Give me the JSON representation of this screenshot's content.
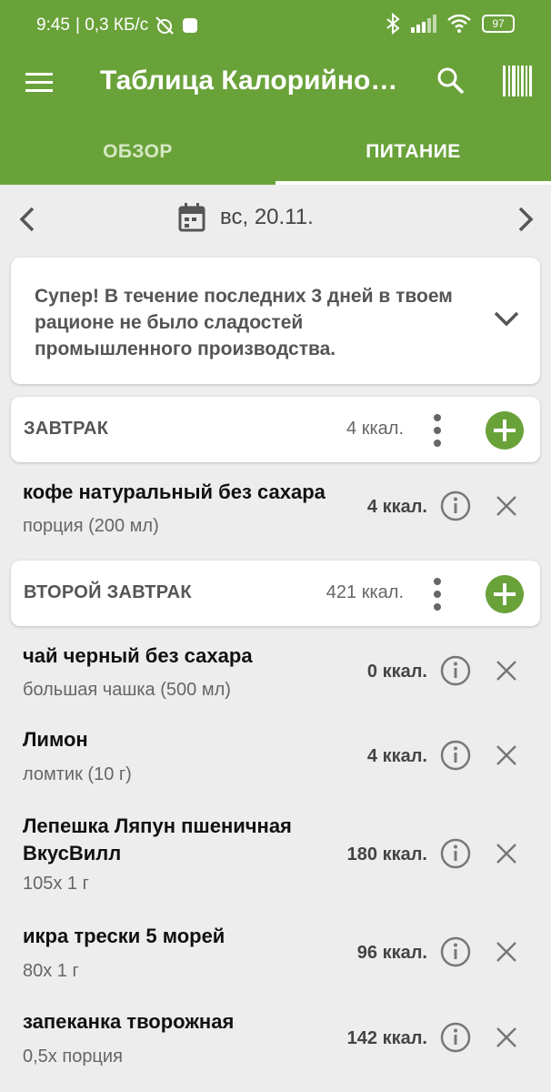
{
  "status_bar": {
    "time": "9:45",
    "net_speed": "| 0,3 КБ/с",
    "battery": "97"
  },
  "toolbar": {
    "title": "Таблица Калорийно…"
  },
  "tabs": [
    {
      "label": "ОБЗОР",
      "active": false
    },
    {
      "label": "ПИТАНИЕ",
      "active": true
    }
  ],
  "date_nav": {
    "date": "вс, 20.11."
  },
  "tip": {
    "text": "Супер! В течение последних 3 дней в твоем рационе не было сладостей промышленного производства."
  },
  "meals": [
    {
      "title": "ЗАВТРАК",
      "kcal": "4 ккал.",
      "items": [
        {
          "name": "кофе натуральный без сахара",
          "portion": "порция (200 мл)",
          "kcal": "4 ккал."
        }
      ]
    },
    {
      "title": "ВТОРОЙ ЗАВТРАК",
      "kcal": "421 ккал.",
      "items": [
        {
          "name": "чай черный без сахара",
          "portion": "большая чашка (500 мл)",
          "kcal": "0 ккал."
        },
        {
          "name": "Лимон",
          "portion": "ломтик (10 г)",
          "kcal": "4 ккал."
        },
        {
          "name": "Лепешка Ляпун пшеничная ВкусВилл",
          "portion": "105x 1 г",
          "kcal": "180 ккал."
        },
        {
          "name": "икра трески 5 морей",
          "portion": "80x 1 г",
          "kcal": "96 ккал."
        },
        {
          "name": "запеканка творожная",
          "portion": "0,5x порция",
          "kcal": "142 ккал."
        }
      ]
    }
  ],
  "colors": {
    "brand_green": "#6aa23a",
    "background": "#ededed"
  }
}
